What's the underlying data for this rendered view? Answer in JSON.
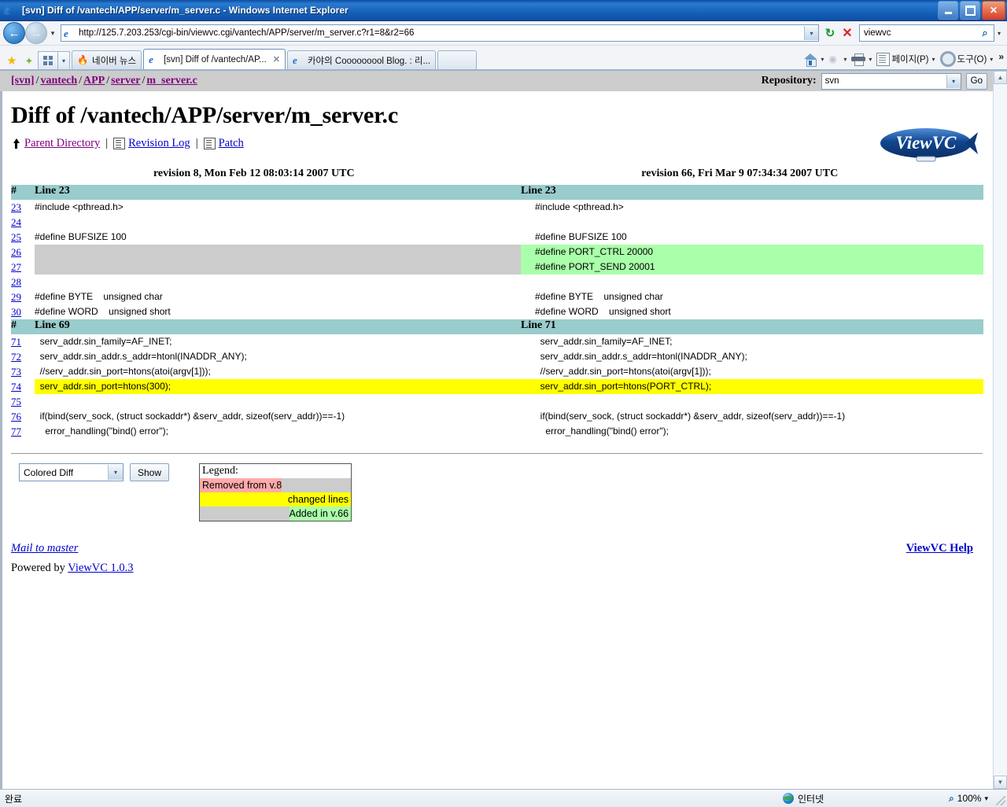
{
  "window": {
    "title": "[svn] Diff of /vantech/APP/server/m_server.c - Windows Internet Explorer",
    "minimize_label": "–",
    "restore_label": "❐",
    "close_label": "✕"
  },
  "address_bar": {
    "url": "http://125.7.203.253/cgi-bin/viewvc.cgi/vantech/APP/server/m_server.c?r1=8&r2=66",
    "refresh_icon": "refresh-icon",
    "stop_icon": "stop-icon",
    "search_value": "viewvc",
    "search_icon": "search-icon",
    "back_icon": "back-arrow-icon",
    "forward_icon": "forward-arrow-icon"
  },
  "tabs": [
    {
      "label": "네이버 뉴스",
      "active": false
    },
    {
      "label": "[svn] Diff of /vantech/AP...",
      "active": true,
      "close": "✕"
    },
    {
      "label": "카야의 Cooooooool Blog. : 리...",
      "active": false
    }
  ],
  "toolbar": {
    "home_label": "",
    "feed_label": "",
    "print_label": "",
    "page_label": "페이지(P)",
    "tools_label": "도구(O)",
    "overflow_label": "»",
    "caret": "▾"
  },
  "viewvc": {
    "breadcrumb": [
      {
        "label": "[svn]"
      },
      {
        "label": "vantech"
      },
      {
        "label": "APP"
      },
      {
        "label": "server"
      },
      {
        "label": "m_server.c"
      }
    ],
    "breadcrumb_sep": "/",
    "repository_label": "Repository:",
    "repository_value": "svn",
    "go_label": "Go",
    "logo_text": "ViewVC",
    "page_title": "Diff of /vantech/APP/server/m_server.c",
    "nav_links": {
      "parent_directory": "Parent Directory",
      "revision_log": "Revision Log",
      "patch": "Patch",
      "separator": "|"
    },
    "left_revision_header": "revision 8, Mon Feb 12 08:03:14 2007 UTC",
    "right_revision_header": "revision 66, Fri Mar 9 07:34:34 2007 UTC",
    "hash_col_header": "#",
    "controls": {
      "diff_format_value": "Colored Diff",
      "show_label": "Show"
    },
    "legend": {
      "title": "Legend:",
      "removed": "Removed from v.8",
      "changed": "changed lines",
      "added": "Added in v.66"
    },
    "footer": {
      "mail_to": "Mail to master",
      "help": "ViewVC Help",
      "powered_prefix": "Powered by ",
      "powered_link": "ViewVC 1.0.3"
    },
    "colors": {
      "header_bg": "#99cccc",
      "topbar_bg": "#cccccc",
      "added": "#aaffaa",
      "changed": "#ffff00",
      "removed": "#ffaaaa",
      "empty": "#cccccc",
      "link": "#0000cc",
      "visited_link": "#800080"
    },
    "hunks": [
      {
        "left_header": "Line 23",
        "right_header": "Line 23",
        "rows": [
          {
            "num": "23",
            "left": "#include <pthread.h>",
            "right": "#include <pthread.h>",
            "state": "same"
          },
          {
            "num": "24",
            "left": "",
            "right": "",
            "state": "same"
          },
          {
            "num": "25",
            "left": "#define BUFSIZE 100",
            "right": "#define BUFSIZE 100",
            "state": "same"
          },
          {
            "num": "26",
            "left": "",
            "right": "#define PORT_CTRL 20000",
            "state": "added"
          },
          {
            "num": "27",
            "left": "",
            "right": "#define PORT_SEND 20001",
            "state": "added"
          },
          {
            "num": "28",
            "left": "",
            "right": "",
            "state": "same"
          },
          {
            "num": "29",
            "left": "#define BYTE    unsigned char",
            "right": "#define BYTE    unsigned char",
            "state": "same"
          },
          {
            "num": "30",
            "left": "#define WORD    unsigned short",
            "right": "#define WORD    unsigned short",
            "state": "same"
          }
        ]
      },
      {
        "left_header": "Line 69",
        "right_header": "Line 71",
        "rows": [
          {
            "num": "71",
            "left": "  serv_addr.sin_family=AF_INET;",
            "right": "  serv_addr.sin_family=AF_INET;",
            "state": "same"
          },
          {
            "num": "72",
            "left": "  serv_addr.sin_addr.s_addr=htonl(INADDR_ANY);",
            "right": "  serv_addr.sin_addr.s_addr=htonl(INADDR_ANY);",
            "state": "same"
          },
          {
            "num": "73",
            "left": "  //serv_addr.sin_port=htons(atoi(argv[1]));",
            "right": "  //serv_addr.sin_port=htons(atoi(argv[1]));",
            "state": "same"
          },
          {
            "num": "74",
            "left": "  serv_addr.sin_port=htons(300);",
            "right": "  serv_addr.sin_port=htons(PORT_CTRL);",
            "state": "changed"
          },
          {
            "num": "75",
            "left": "",
            "right": "",
            "state": "same"
          },
          {
            "num": "76",
            "left": "  if(bind(serv_sock, (struct sockaddr*) &serv_addr, sizeof(serv_addr))==-1)",
            "right": "  if(bind(serv_sock, (struct sockaddr*) &serv_addr, sizeof(serv_addr))==-1)",
            "state": "same"
          },
          {
            "num": "77",
            "left": "    error_handling(\"bind() error\");",
            "right": "    error_handling(\"bind() error\");",
            "state": "same"
          }
        ]
      }
    ]
  },
  "status_bar": {
    "status_text": "완료",
    "zone_text": "인터넷",
    "zoom_text": "100%",
    "zoom_caret": "▾"
  }
}
